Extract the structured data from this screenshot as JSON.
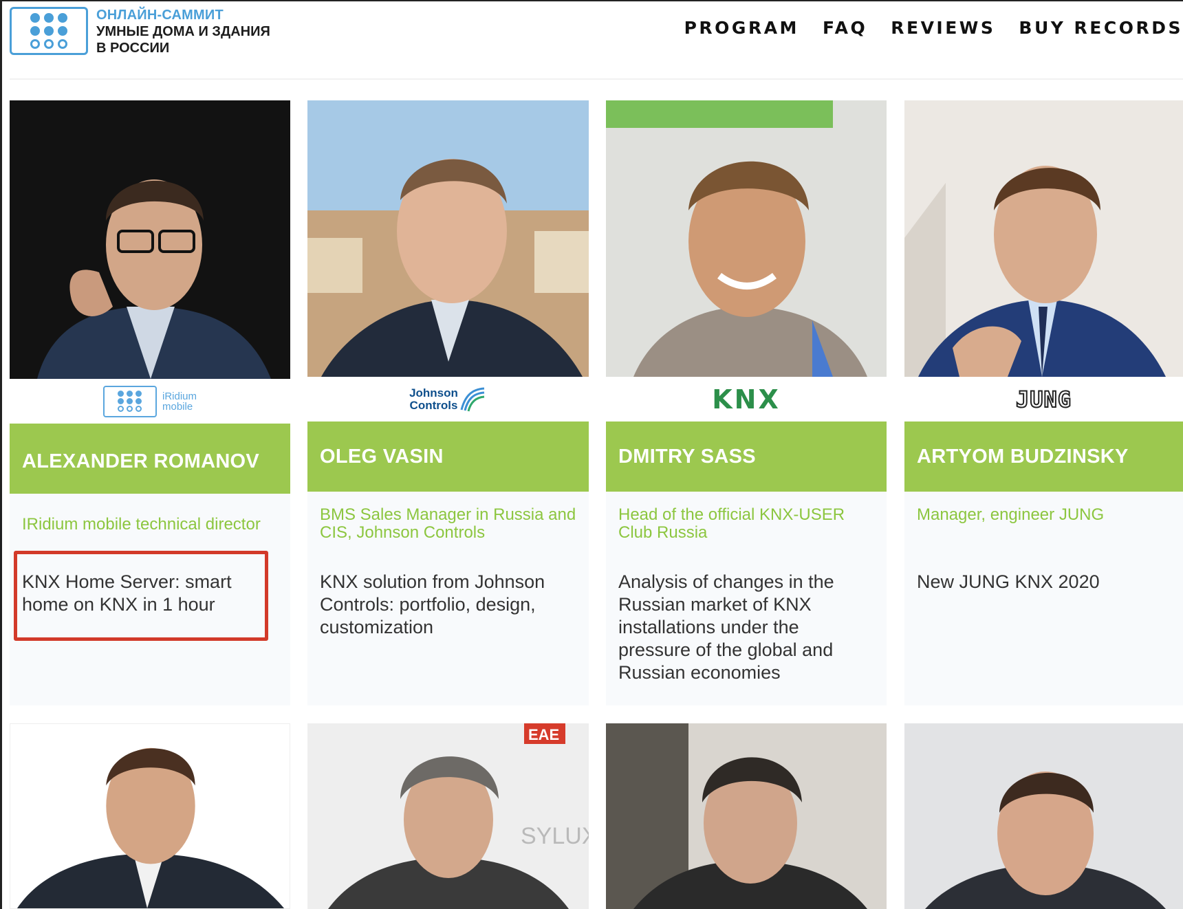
{
  "header": {
    "logo": {
      "line1": "ОНЛАЙН-САММИТ",
      "line2": "УМНЫЕ ДОМА И ЗДАНИЯ",
      "line3": "В РОССИИ"
    },
    "nav": [
      "PROGRAM",
      "FAQ",
      "REVIEWS",
      "BUY RECORDS"
    ]
  },
  "speakers": [
    {
      "name": "ALEXANDER ROMANOV",
      "company_logo": "iridium-mobile-logo",
      "company_text": [
        "iRidium",
        "mobile"
      ],
      "role": "IRidium mobile technical director",
      "talk": "KNX Home Server: smart home on KNX in 1 hour",
      "highlighted": true
    },
    {
      "name": "OLEG VASIN",
      "company_logo": "johnson-controls-logo",
      "company_text": [
        "Johnson",
        "Controls"
      ],
      "role": "BMS Sales Manager in Russia and CIS, Johnson Controls",
      "talk": "KNX solution from Johnson Controls: portfolio, design, customization",
      "highlighted": false
    },
    {
      "name": "DMITRY SASS",
      "company_logo": "knx-logo",
      "company_text": [
        "KNX"
      ],
      "role": "Head of the official KNX-USER Club Russia",
      "talk": "Analysis of changes in the Russian market of KNX installations under the pressure of the global and Russian economies",
      "highlighted": false
    },
    {
      "name": "ARTYOM BUDZINSKY",
      "company_logo": "jung-logo",
      "company_text": [
        "JUNG"
      ],
      "role": "Manager, engineer JUNG",
      "talk": "New JUNG KNX 2020",
      "highlighted": false
    }
  ],
  "second_row_backdrop_text": [
    "SYLUX",
    "EAE"
  ],
  "colors": {
    "accent_green": "#9cc84f",
    "role_green": "#8cc63f",
    "brand_blue": "#4a9fd8",
    "highlight_red": "#d23a2a"
  }
}
